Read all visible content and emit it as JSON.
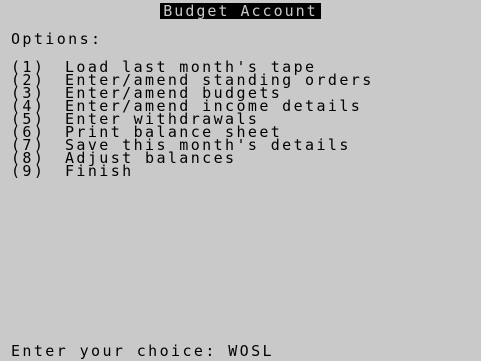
{
  "header": {
    "title": "Budget Account"
  },
  "options_heading": "Options:",
  "menu": {
    "items": [
      {
        "number": "(1)",
        "label": "Load last month's tape"
      },
      {
        "number": "(2)",
        "label": "Enter/amend standing orders"
      },
      {
        "number": "(3)",
        "label": "Enter/amend budgets"
      },
      {
        "number": "(4)",
        "label": "Enter/amend income details"
      },
      {
        "number": "(5)",
        "label": "Enter withdrawals"
      },
      {
        "number": "(6)",
        "label": "Print balance sheet"
      },
      {
        "number": "(7)",
        "label": "Save this month's details"
      },
      {
        "number": "(8)",
        "label": "Adjust balances"
      },
      {
        "number": "(9)",
        "label": "Finish"
      }
    ]
  },
  "prompt": {
    "label": "Enter your choice:",
    "value": "WOSL"
  },
  "colors": {
    "background": "#c9c9c9",
    "text": "#000000",
    "title_background": "#000000",
    "title_text": "#c9c9c9"
  }
}
